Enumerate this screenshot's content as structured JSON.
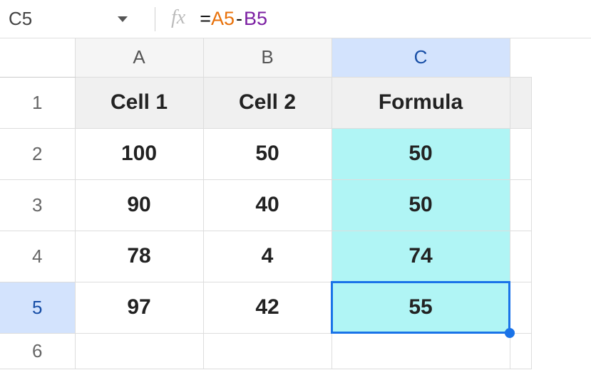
{
  "nameBox": "C5",
  "formulaBar": {
    "eq": "=",
    "ref1": "A5",
    "op": "-",
    "ref2": "B5"
  },
  "columns": [
    "A",
    "B",
    "C"
  ],
  "rows": [
    "1",
    "2",
    "3",
    "4",
    "5",
    "6"
  ],
  "headers": {
    "a": "Cell 1",
    "b": "Cell 2",
    "c": "Formula"
  },
  "data": [
    {
      "a": "100",
      "b": "50",
      "c": "50"
    },
    {
      "a": "90",
      "b": "40",
      "c": "50"
    },
    {
      "a": "78",
      "b": "4",
      "c": "74"
    },
    {
      "a": "97",
      "b": "42",
      "c": "55"
    }
  ],
  "activeCell": {
    "row": 5,
    "col": "C"
  }
}
